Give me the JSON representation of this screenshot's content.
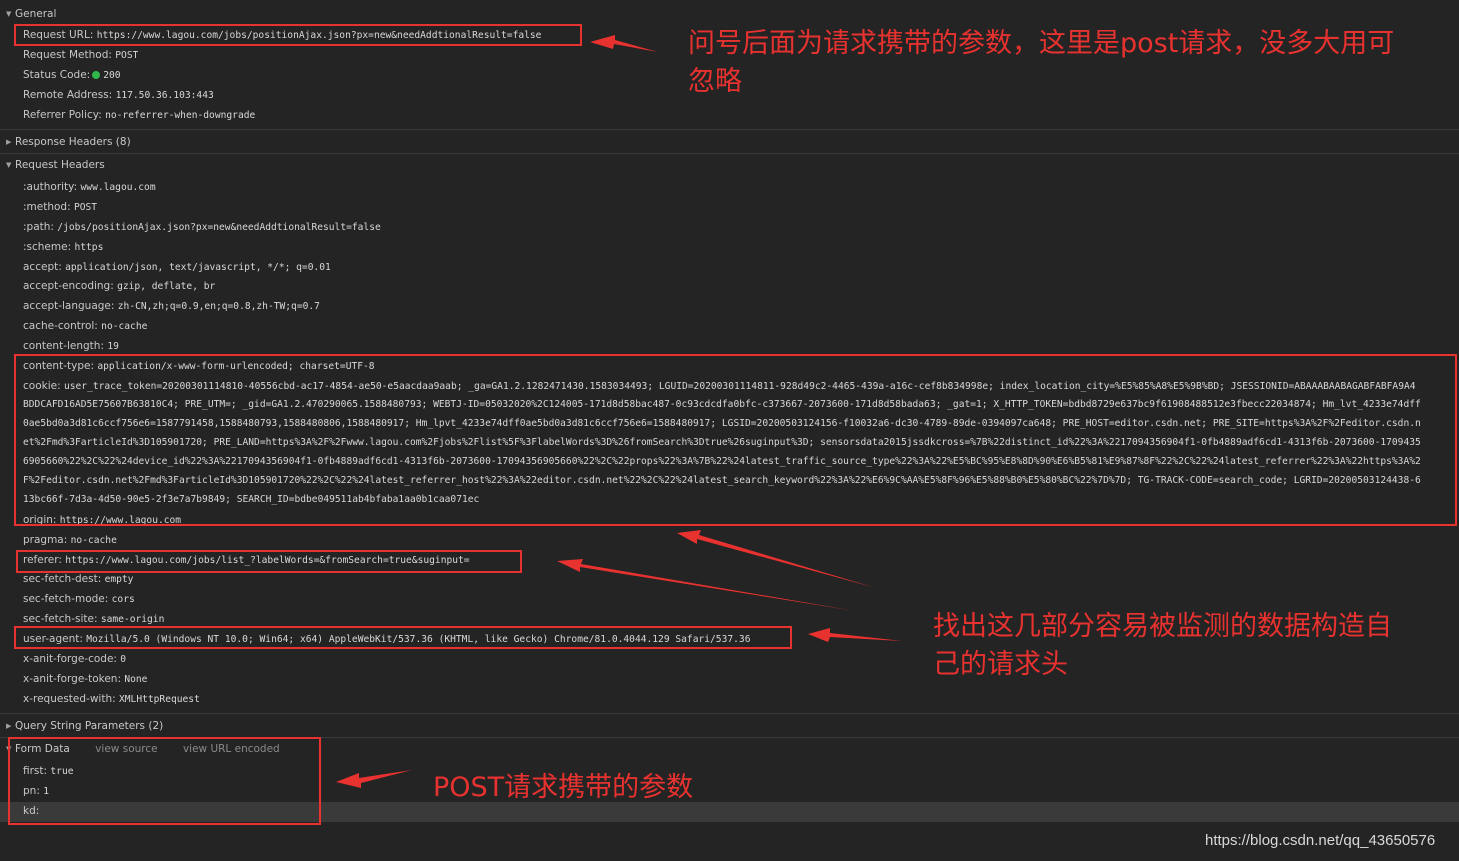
{
  "sections": {
    "general": "General",
    "response_headers": "Response Headers (8)",
    "request_headers": "Request Headers",
    "query_string": "Query String Parameters (2)",
    "form_data": "Form Data",
    "view_source": "view source",
    "view_url_encoded": "view URL encoded"
  },
  "general": {
    "request_url_label": "Request URL:",
    "request_url": "https://www.lagou.com/jobs/positionAjax.json?px=new&needAddtionalResult=false",
    "request_method_label": "Request Method:",
    "request_method": "POST",
    "status_code_label": "Status Code:",
    "status_code": "200",
    "remote_address_label": "Remote Address:",
    "remote_address": "117.50.36.103:443",
    "referrer_policy_label": "Referrer Policy:",
    "referrer_policy": "no-referrer-when-downgrade"
  },
  "request_headers": {
    "authority_label": ":authority:",
    "authority": "www.lagou.com",
    "method_label": ":method:",
    "method": "POST",
    "path_label": ":path:",
    "path": "/jobs/positionAjax.json?px=new&needAddtionalResult=false",
    "scheme_label": ":scheme:",
    "scheme": "https",
    "accept_label": "accept:",
    "accept": "application/json, text/javascript, */*; q=0.01",
    "accept_encoding_label": "accept-encoding:",
    "accept_encoding": "gzip, deflate, br",
    "accept_language_label": "accept-language:",
    "accept_language": "zh-CN,zh;q=0.9,en;q=0.8,zh-TW;q=0.7",
    "cache_control_label": "cache-control:",
    "cache_control": "no-cache",
    "content_length_label": "content-length:",
    "content_length": "19",
    "content_type_label": "content-type:",
    "content_type": "application/x-www-form-urlencoded; charset=UTF-8",
    "cookie_label": "cookie:",
    "cookie_line1": "user_trace_token=20200301114810-40556cbd-ac17-4854-ae50-e5aacdaa9aab; _ga=GA1.2.1282471430.1583034493; LGUID=20200301114811-928d49c2-4465-439a-a16c-cef8b834998e; index_location_city=%E5%85%A8%E5%9B%BD; JSESSIONID=ABAAABAABAGABFABFA9A4",
    "cookie_line2": "BDDCAFD16AD5E75607B63810C4; PRE_UTM=; _gid=GA1.2.470290065.1588480793; WEBTJ-ID=05032020%2C124005-171d8d58bac487-0c93cdcdfa0bfc-c373667-2073600-171d8d58bada63; _gat=1; X_HTTP_TOKEN=bdbd8729e637bc9f61908488512e3fbecc22034874; Hm_lvt_4233e74dff",
    "cookie_line3": "0ae5bd0a3d81c6ccf756e6=1587791458,1588480793,1588480806,1588480917; Hm_lpvt_4233e74dff0ae5bd0a3d81c6ccf756e6=1588480917; LGSID=20200503124156-f10032a6-dc30-4789-89de-0394097ca648; PRE_HOST=editor.csdn.net; PRE_SITE=https%3A%2F%2Feditor.csdn.n",
    "cookie_line4": "et%2Fmd%3FarticleId%3D105901720; PRE_LAND=https%3A%2F%2Fwww.lagou.com%2Fjobs%2Flist%5F%3FlabelWords%3D%26fromSearch%3Dtrue%26suginput%3D; sensorsdata2015jssdkcross=%7B%22distinct_id%22%3A%2217094356904f1-0fb4889adf6cd1-4313f6b-2073600-1709435",
    "cookie_line5": "6905660%22%2C%22%24device_id%22%3A%2217094356904f1-0fb4889adf6cd1-4313f6b-2073600-17094356905660%22%2C%22props%22%3A%7B%22%24latest_traffic_source_type%22%3A%22%E5%BC%95%E8%8D%90%E6%B5%81%E9%87%8F%22%2C%22%24latest_referrer%22%3A%22https%3A%2",
    "cookie_line6": "F%2Feditor.csdn.net%2Fmd%3FarticleId%3D105901720%22%2C%22%24latest_referrer_host%22%3A%22editor.csdn.net%22%2C%22%24latest_search_keyword%22%3A%22%E6%9C%AA%E5%8F%96%E5%88%B0%E5%80%BC%22%7D%7D; TG-TRACK-CODE=search_code; LGRID=20200503124438-6",
    "cookie_line7": "13bc66f-7d3a-4d50-90e5-2f3e7a7b9849; SEARCH_ID=bdbe049511ab4bfaba1aa0b1caa071ec",
    "origin_label": "origin:",
    "origin": "https://www.lagou.com",
    "pragma_label": "pragma:",
    "pragma": "no-cache",
    "referer_label": "referer:",
    "referer": "https://www.lagou.com/jobs/list_?labelWords=&fromSearch=true&suginput=",
    "sec_fetch_dest_label": "sec-fetch-dest:",
    "sec_fetch_dest": "empty",
    "sec_fetch_mode_label": "sec-fetch-mode:",
    "sec_fetch_mode": "cors",
    "sec_fetch_site_label": "sec-fetch-site:",
    "sec_fetch_site": "same-origin",
    "user_agent_label": "user-agent:",
    "user_agent": "Mozilla/5.0 (Windows NT 10.0; Win64; x64) AppleWebKit/537.36 (KHTML, like Gecko) Chrome/81.0.4044.129 Safari/537.36",
    "anit_forge_code_label": "x-anit-forge-code:",
    "anit_forge_code": "0",
    "anit_forge_token_label": "x-anit-forge-token:",
    "anit_forge_token": "None",
    "requested_with_label": "x-requested-with:",
    "requested_with": "XMLHttpRequest"
  },
  "form_data": {
    "first_label": "first:",
    "first": "true",
    "pn_label": "pn:",
    "pn": "1",
    "kd_label": "kd:",
    "kd": ""
  },
  "annotations": {
    "note1_line1": "问号后面为请求携带的参数，这里是post请求，没多大用可",
    "note1_line2": "忽略",
    "note2_line1": "找出这几部分容易被监测的数据构造自",
    "note2_line2": "己的请求头",
    "note3": "POST请求携带的参数",
    "color": "#e8322f"
  },
  "watermark": "https://blog.csdn.net/qq_43650576",
  "icons": {
    "expanded": "triangle-down-icon",
    "collapsed": "triangle-right-icon",
    "status": "status-dot-icon"
  }
}
